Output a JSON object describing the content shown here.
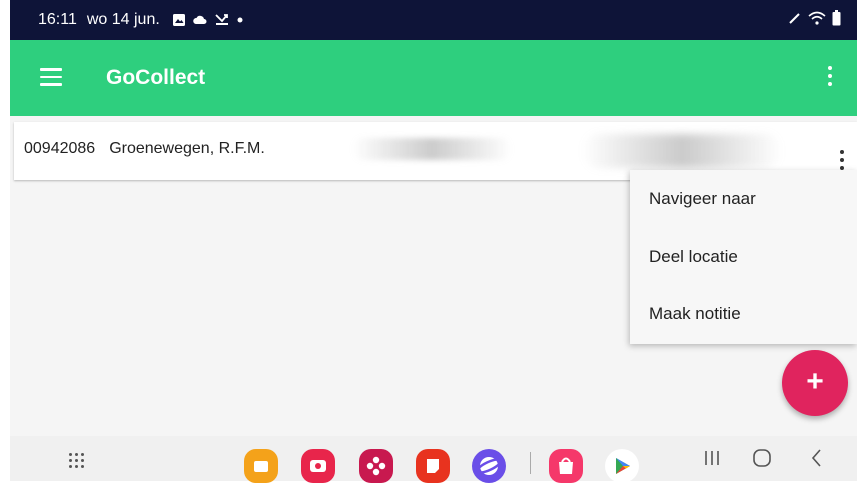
{
  "status_bar": {
    "time": "16:11",
    "date": "wo 14 jun.",
    "notification_icons": [
      "image-icon",
      "cloud-icon",
      "missed-call-icon",
      "dot-icon"
    ],
    "right_icons": [
      "pen-icon",
      "wifi-icon",
      "battery-icon"
    ]
  },
  "app_bar": {
    "title": "GoCollect",
    "color": "#2ecf7e"
  },
  "list": {
    "items": [
      {
        "number": "00942086",
        "name": "Groenewegen, R.F.M."
      }
    ]
  },
  "context_menu": {
    "items": [
      {
        "label": "Navigeer naar"
      },
      {
        "label": "Deel locatie"
      },
      {
        "label": "Maak notitie"
      }
    ]
  },
  "fab": {
    "label": "+",
    "color": "#e0245e"
  },
  "taskbar": {
    "apps": [
      "my-files-app",
      "screen-recorder-app",
      "gallery-app",
      "notes-app",
      "internet-app",
      "galaxy-store-app",
      "play-store-app"
    ],
    "nav": [
      "recents-button",
      "home-button",
      "back-button"
    ]
  }
}
